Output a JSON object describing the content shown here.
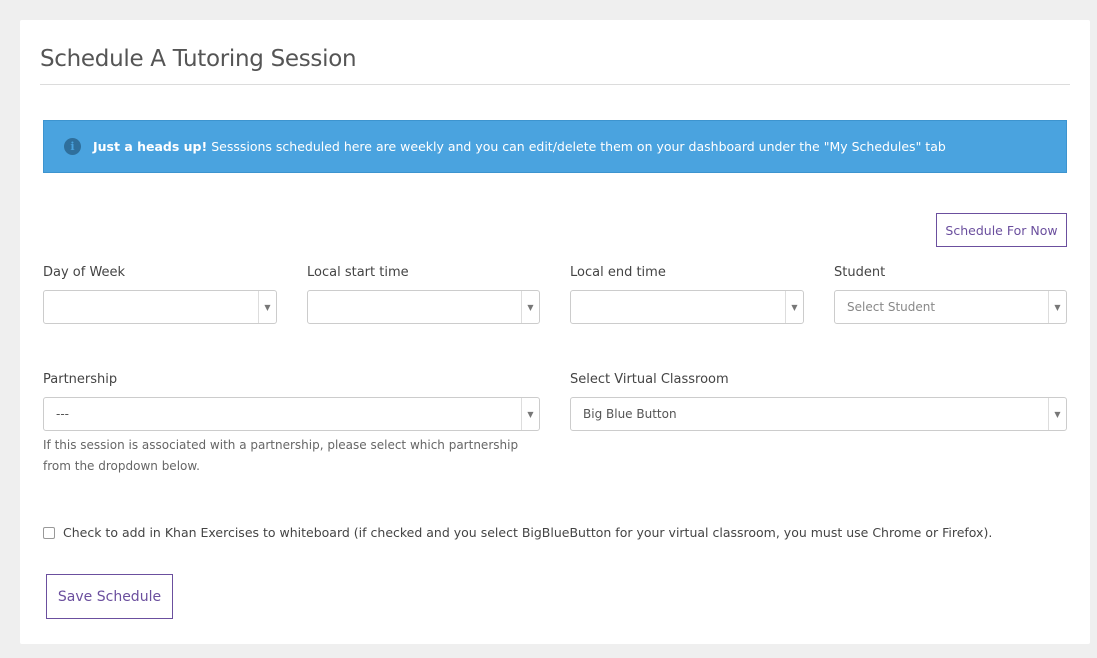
{
  "page": {
    "title": "Schedule A Tutoring Session"
  },
  "alert": {
    "icon": "info-icon",
    "strong": "Just a heads up!",
    "text": "Sesssions scheduled here are weekly and you can edit/delete them on your dashboard under the \"My Schedules\" tab"
  },
  "actions": {
    "schedule_now": "Schedule For Now",
    "save": "Save Schedule"
  },
  "fields": {
    "day_of_week": {
      "label": "Day of Week",
      "value": ""
    },
    "start_time": {
      "label": "Local start time",
      "value": ""
    },
    "end_time": {
      "label": "Local end time",
      "value": ""
    },
    "student": {
      "label": "Student",
      "placeholder": "Select Student"
    },
    "partnership": {
      "label": "Partnership",
      "value": "---",
      "help": "If this session is associated with a partnership, please select which partnership from the dropdown below."
    },
    "virtual_classroom": {
      "label": "Select Virtual Classroom",
      "value": "Big Blue Button"
    }
  },
  "khan_checkbox": {
    "checked": false,
    "label": "Check to add in Khan Exercises to whiteboard (if checked and you select BigBlueButton for your virtual classroom, you must use Chrome or Firefox)."
  },
  "colors": {
    "alert_bg": "#4aa3df",
    "accent": "#6b4f9e"
  }
}
